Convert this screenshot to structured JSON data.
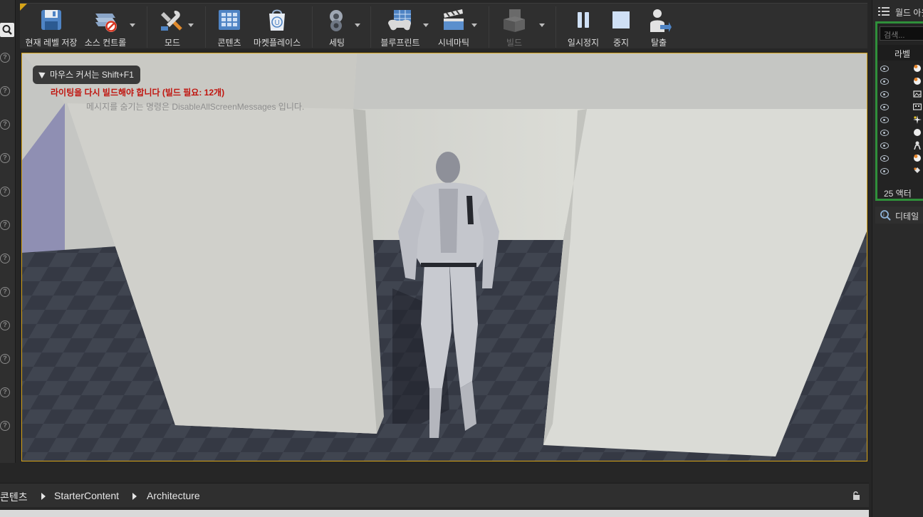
{
  "toolbar": {
    "buttons": [
      {
        "label": "현재 레벨 저장",
        "icon": "save-icon"
      },
      {
        "label": "소스 컨트롤",
        "icon": "source-control-icon"
      },
      {
        "label": "모드",
        "icon": "modes-icon"
      },
      {
        "label": "콘텐츠",
        "icon": "content-icon"
      },
      {
        "label": "마켓플레이스",
        "icon": "marketplace-icon"
      },
      {
        "label": "세팅",
        "icon": "settings-icon"
      },
      {
        "label": "블루프린트",
        "icon": "blueprint-icon"
      },
      {
        "label": "시네마틱",
        "icon": "cinematics-icon"
      },
      {
        "label": "빌드",
        "icon": "build-icon",
        "disabled": true
      },
      {
        "label": "일시정지",
        "icon": "pause-icon"
      },
      {
        "label": "중지",
        "icon": "stop-icon"
      },
      {
        "label": "탈출",
        "icon": "eject-icon"
      }
    ]
  },
  "viewport": {
    "tooltip": "마우스 커서는 Shift+F1",
    "warning": "라이팅을 다시 빌드해야 합니다 (빌드 필요: 12개)",
    "hint": "메시지를 숨기는 명령은 DisableAllScreenMessages 입니다."
  },
  "content_browser": {
    "breadcrumb": [
      "콘텐츠",
      "StarterContent",
      "Architecture"
    ]
  },
  "world_outliner": {
    "title": "월드 아웃",
    "search_placeholder": "검색...",
    "column_label": "라벨",
    "actor_icons": [
      "light-bulb-icon",
      "light-bulb-icon",
      "image-icon",
      "film-icon",
      "sparkle-icon",
      "sphere-icon",
      "character-icon",
      "light-bulb-icon",
      "player-start-icon"
    ],
    "actor_count": "25 액터"
  },
  "details": {
    "tab_label": "디테일"
  },
  "colors": {
    "accent": "#d7a418",
    "outliner_frame": "#2f8f3a",
    "warning": "#c0150f"
  }
}
